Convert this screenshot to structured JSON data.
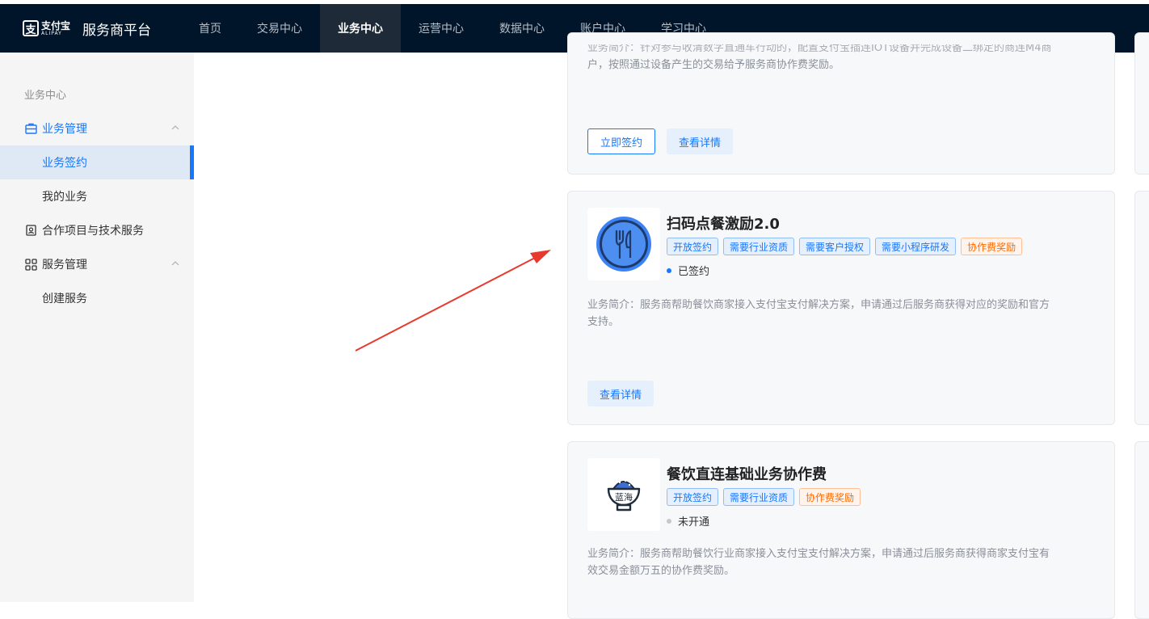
{
  "header": {
    "logo_cn": "支付宝",
    "logo_en": "ALIPAY",
    "title": "服务商平台",
    "nav": [
      "首页",
      "交易中心",
      "业务中心",
      "运营中心",
      "数据中心",
      "账户中心",
      "学习中心"
    ],
    "active_nav": "业务中心"
  },
  "sidebar": {
    "section_title": "业务中心",
    "group1": "业务管理",
    "item_sign": "业务签约",
    "item_mine": "我的业务",
    "group2": "合作项目与技术服务",
    "group3": "服务管理",
    "item_create": "创建服务"
  },
  "cards": {
    "top": {
      "desc_line1": "业务简介：针对参与收清数字直通车行动的，配置支付宝插连IOT设备并完成设备二绑定的商连M4商",
      "desc_line2": "户，按照通过设备产生的交易给予服务商协作费奖励。",
      "btn_sign": "立即签约",
      "btn_detail": "查看详情"
    },
    "middle": {
      "title": "扫码点餐激励2.0",
      "tags": [
        "开放签约",
        "需要行业资质",
        "需要客户授权",
        "需要小程序研发",
        "协作费奖励"
      ],
      "status": "已签约",
      "desc_line1": "业务简介：服务商帮助餐饮商家接入支付宝支付解决方案，申请通过后服务商获得对应的奖励和官方",
      "desc_line2": "支持。",
      "btn_detail": "查看详情"
    },
    "bottom": {
      "title": "餐饮直连基础业务协作费",
      "logo_text": "蓝海",
      "tags": [
        "开放签约",
        "需要行业资质",
        "协作费奖励"
      ],
      "status": "未开通",
      "desc_line1": "业务简介：服务商帮助餐饮行业商家接入支付宝支付解决方案，申请通过后服务商获得商家支付宝有",
      "desc_line2": "效交易金额万五的协作费奖励。"
    }
  },
  "colors": {
    "nav_bg": "#001529",
    "accent": "#1677ff",
    "annotation_arrow": "#e8392f",
    "status_signed": "#1677ff",
    "status_unopened": "#c8c8c8"
  }
}
